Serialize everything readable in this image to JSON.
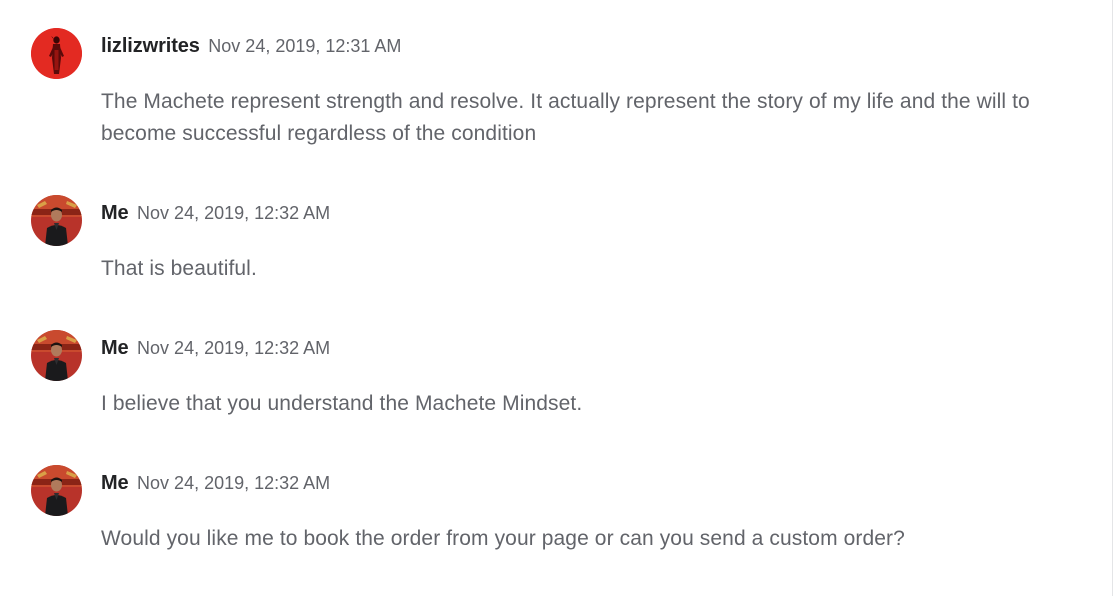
{
  "messages": [
    {
      "username": "lizlizwrites",
      "timestamp": "Nov 24, 2019, 12:31 AM",
      "text": "The Machete represent strength and resolve. It actually represent the story of my life and the will to become successful regardless of the condition",
      "avatar_icon": "red-figure-avatar"
    },
    {
      "username": "Me",
      "timestamp": "Nov 24, 2019, 12:32 AM",
      "text": "That is beautiful.",
      "avatar_icon": "person-photo-avatar"
    },
    {
      "username": "Me",
      "timestamp": "Nov 24, 2019, 12:32 AM",
      "text": "I believe that you understand the Machete Mindset.",
      "avatar_icon": "person-photo-avatar"
    },
    {
      "username": "Me",
      "timestamp": "Nov 24, 2019, 12:32 AM",
      "text": "Would you like me to book the order from your page or can you send a custom order?",
      "avatar_icon": "person-photo-avatar"
    }
  ],
  "colors": {
    "username": "#222325",
    "secondary_text": "#62646a",
    "avatar_red": "#e0231e",
    "avatar_me_bg": "#c0392b"
  }
}
